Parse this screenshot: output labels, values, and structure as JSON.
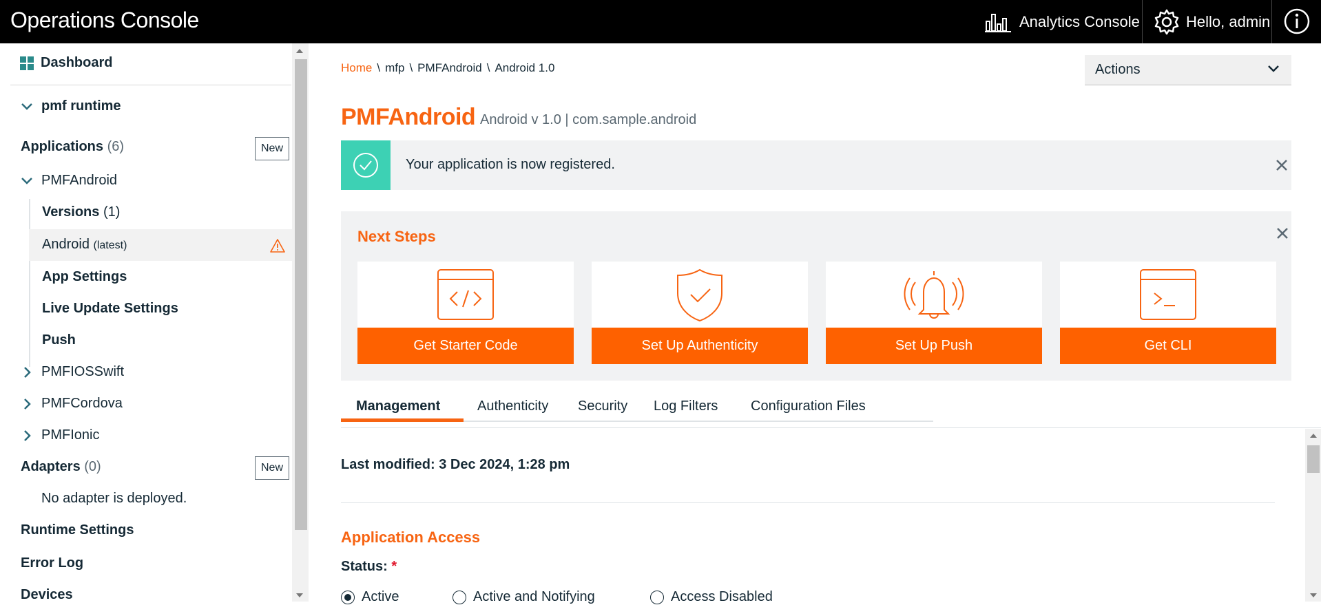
{
  "topbar": {
    "title": "Operations Console",
    "analytics_label": "Analytics Console",
    "user_label": "Hello, admin"
  },
  "sidebar": {
    "dashboard": "Dashboard",
    "runtime": "pmf runtime",
    "applications_label": "Applications",
    "applications_count": "(6)",
    "new_label": "New",
    "app_pmfandroid": "PMFAndroid",
    "versions_label": "Versions",
    "versions_count": "(1)",
    "android_label": "Android",
    "android_latest": "(latest)",
    "app_settings": "App Settings",
    "live_update": "Live Update Settings",
    "push": "Push",
    "app_ios": "PMFIOSSwift",
    "app_cordova": "PMFCordova",
    "app_ionic": "PMFIonic",
    "adapters_label": "Adapters",
    "adapters_count": "(0)",
    "no_adapter": "No adapter is deployed.",
    "runtime_settings": "Runtime Settings",
    "error_log": "Error Log",
    "devices": "Devices"
  },
  "breadcrumb": [
    "Home",
    "\\",
    "mfp",
    "\\",
    "PMFAndroid",
    "\\",
    "Android 1.0"
  ],
  "actions_label": "Actions",
  "app": {
    "name": "PMFAndroid",
    "subtitle": "Android v 1.0 | com.sample.android"
  },
  "notice": "Your application is now registered.",
  "next_steps": {
    "title": "Next Steps",
    "cards": [
      "Get Starter Code",
      "Set Up Authenticity",
      "Set Up Push",
      "Get CLI"
    ]
  },
  "tabs": [
    "Management",
    "Authenticity",
    "Security",
    "Log Filters",
    "Configuration Files"
  ],
  "last_modified": "Last modified: 3 Dec 2024, 1:28 pm",
  "access": {
    "title": "Application Access",
    "status_label": "Status:",
    "required_mark": "*",
    "options": [
      "Active",
      "Active and Notifying",
      "Access Disabled"
    ],
    "selected": "Active"
  },
  "colors": {
    "accent": "#f76412",
    "button": "#fe6100",
    "success": "#3dd1b4",
    "topbar": "#000000"
  }
}
